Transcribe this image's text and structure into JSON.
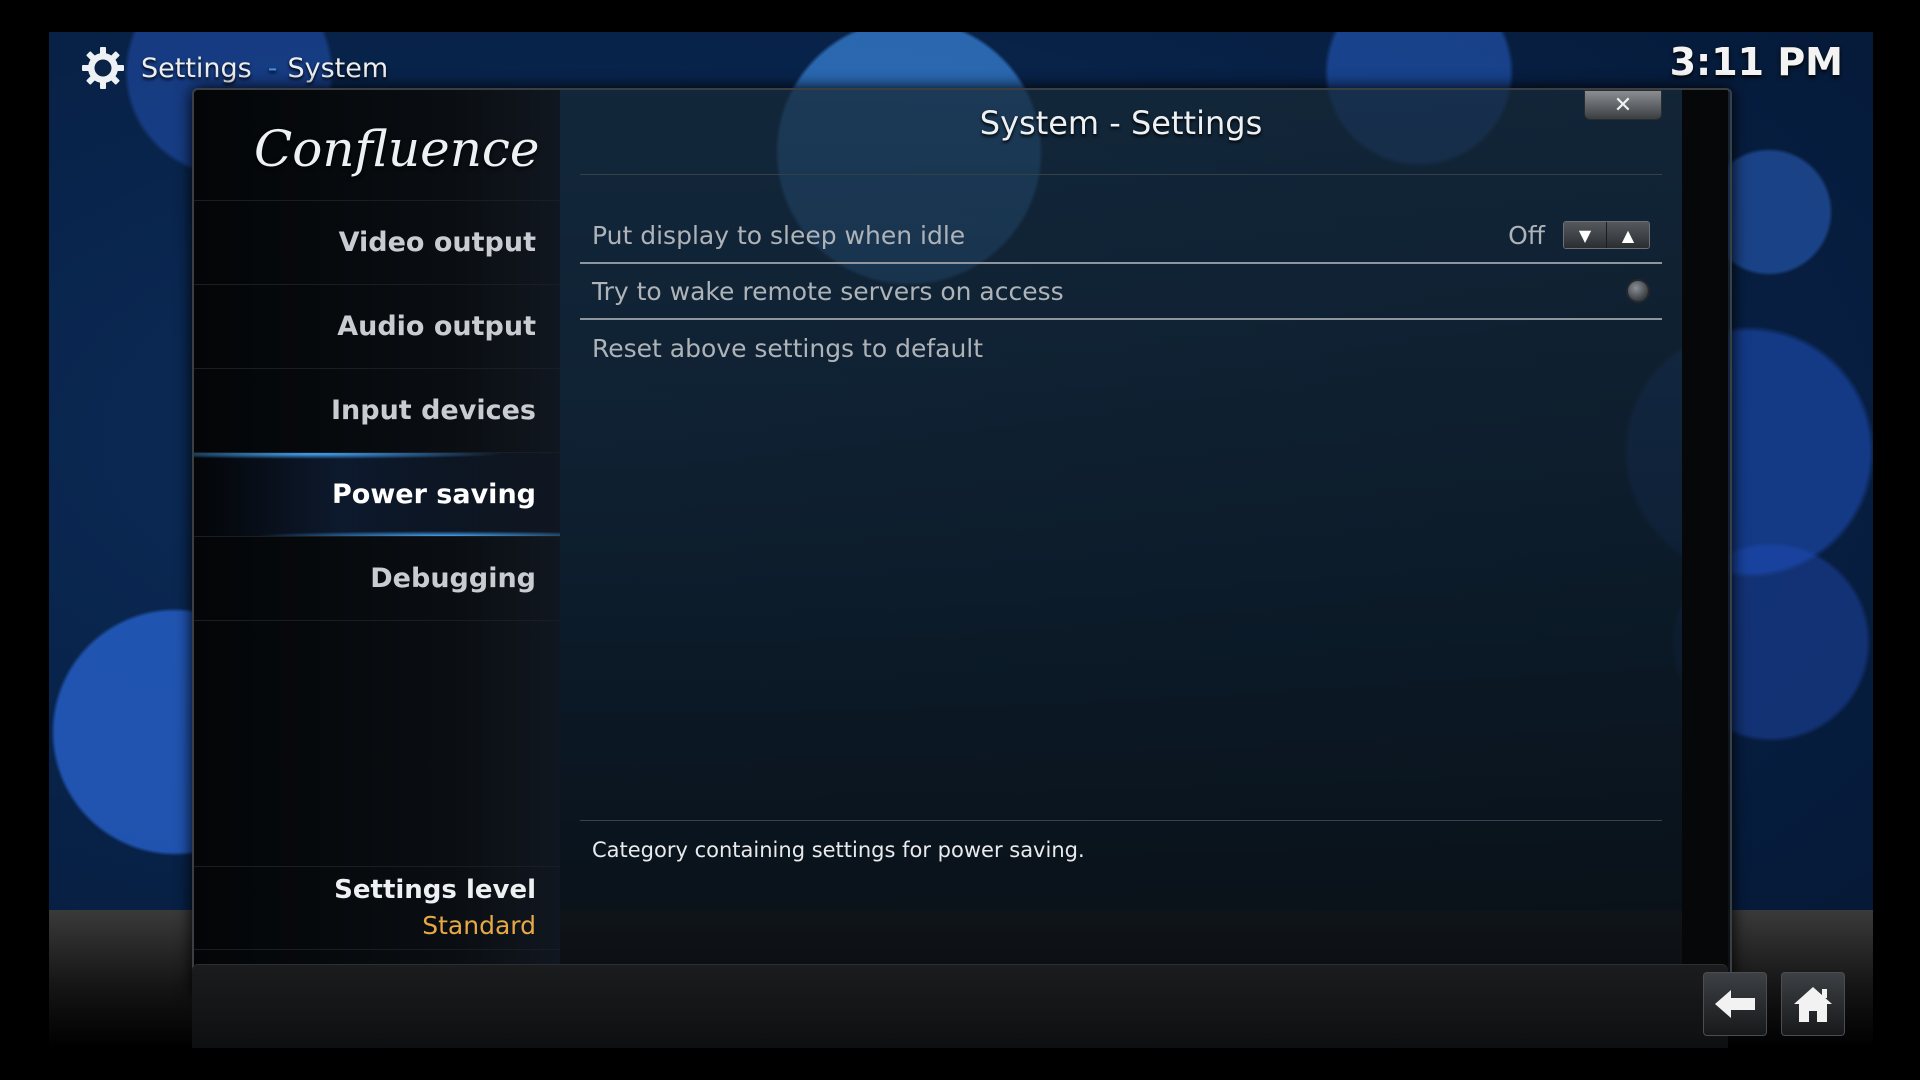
{
  "header": {
    "section": "Settings",
    "separator": "-",
    "subsection": "System",
    "clock": "3:11 PM"
  },
  "dialog": {
    "title": "System - Settings",
    "close_glyph": "✕",
    "logo_text": "Confluence"
  },
  "sidebar": {
    "items": [
      {
        "label": "Video output",
        "active": false
      },
      {
        "label": "Audio output",
        "active": false
      },
      {
        "label": "Input devices",
        "active": false
      },
      {
        "label": "Power saving",
        "active": true
      },
      {
        "label": "Debugging",
        "active": false
      }
    ],
    "level_label": "Settings level",
    "level_value": "Standard"
  },
  "settings": [
    {
      "label": "Put display to sleep when idle",
      "value": "Off",
      "control": "spinner"
    },
    {
      "label": "Try to wake remote servers on access",
      "control": "radio",
      "checked": false
    },
    {
      "label": "Reset above settings to default",
      "control": "action"
    }
  ],
  "description": "Category containing settings for power saving.",
  "icons": {
    "header": "gear-icon",
    "spin_down": "triangle-down-icon",
    "spin_up": "triangle-up-icon",
    "back": "back-arrow-icon",
    "home": "home-icon",
    "close": "close-icon"
  },
  "colors": {
    "accent": "#3d8fe8",
    "level_value": "#e8a845",
    "text": "#d7dadd"
  }
}
